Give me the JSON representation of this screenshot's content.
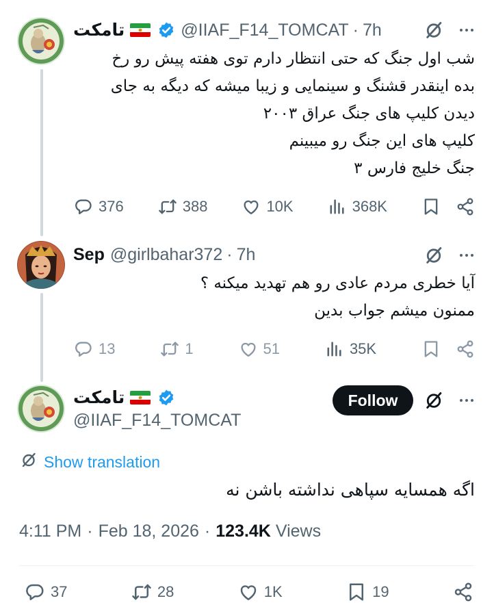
{
  "tweets": [
    {
      "display_name": "تامکت",
      "handle": "@IIAF_F14_TOMCAT",
      "time": "7h",
      "text_lines": [
        "شب اول جنگ که حتی انتظار دارم توی هفته پیش رو رخ",
        "بده اینقدر قشنگ و سینمایی و زیبا میشه که دیگه به جای",
        "دیدن کلیپ های جنگ عراق ۲۰۰۳",
        "کلیپ های  این جنگ رو میبینم",
        "جنگ خلیج فارس ۳"
      ],
      "replies": "376",
      "reposts": "388",
      "likes": "10K",
      "views": "368K"
    },
    {
      "display_name": "Sep",
      "handle": "@girlbahar372",
      "time": "7h",
      "text_lines": [
        "آیا خطری مردم عادی رو هم تهدید میکنه ؟",
        "ممنون میشم جواب بدین"
      ],
      "replies": "13",
      "reposts": "1",
      "likes": "51",
      "views": "35K"
    }
  ],
  "main_tweet": {
    "display_name": "تامکت",
    "handle": "@IIAF_F14_TOMCAT",
    "follow_label": "Follow",
    "translation_label": "Show translation",
    "text": "اگه همسایه سپاهی نداشته باشن نه",
    "time": "4:11 PM",
    "date": "Feb 18, 2026",
    "views_count": "123.4K",
    "views_label": "Views",
    "replies": "37",
    "reposts": "28",
    "likes": "1K",
    "bookmarks": "19"
  },
  "separator": "·",
  "icons": [
    "grok-icon",
    "more-icon",
    "reply-icon",
    "repost-icon",
    "like-icon",
    "views-icon",
    "bookmark-icon",
    "share-icon",
    "verified-icon",
    "iran-flag-icon",
    "translate-icon"
  ],
  "colors": {
    "accent": "#1d9bf0",
    "text": "#0f1419",
    "muted": "#536471",
    "thread_line": "#cfd9de"
  }
}
